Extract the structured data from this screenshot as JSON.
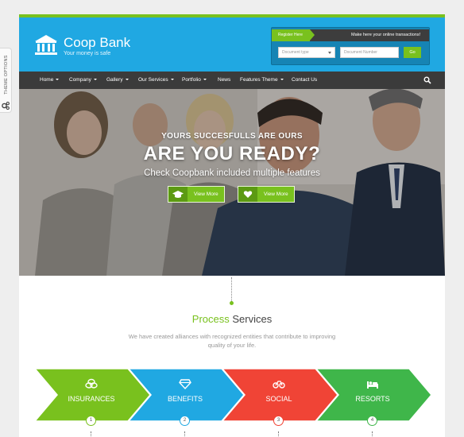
{
  "theme_options": {
    "label": "THEME OPTIONS"
  },
  "header": {
    "logo_title": "Coop Bank",
    "logo_subtitle": "Your money is safe",
    "register_label": "Register Here",
    "transaction_message": "Make here your online transactions!",
    "document_type_placeholder": "Document type",
    "document_number_placeholder": "Document Number",
    "go_label": "Go"
  },
  "nav": {
    "items": [
      {
        "label": "Home"
      },
      {
        "label": "Company"
      },
      {
        "label": "Gallery"
      },
      {
        "label": "Our Services"
      },
      {
        "label": "Portfolio"
      },
      {
        "label": "News"
      },
      {
        "label": "Features Theme"
      },
      {
        "label": "Contact Us"
      }
    ]
  },
  "hero": {
    "small_title": "YOURS SUCCESFULLS ARE OURS",
    "big_title": "ARE YOU READY?",
    "subtitle": "Check Coopbank included multiple features",
    "buttons": [
      {
        "label": "View More",
        "icon": "graduation-cap-icon"
      },
      {
        "label": "View More",
        "icon": "heart-icon"
      }
    ]
  },
  "process": {
    "title_highlight": "Process",
    "title_rest": " Services",
    "description": "We have created alliances with recognized entities that contribute to improving quality of your life.",
    "steps": [
      {
        "label": "INSURANCES",
        "number": "1",
        "color": "#79c11e",
        "icon": "coins-icon"
      },
      {
        "label": "BENEFITS",
        "number": "2",
        "color": "#20a8e2",
        "icon": "diamond-icon"
      },
      {
        "label": "SOCIAL",
        "number": "3",
        "color": "#f04436",
        "icon": "bicycle-icon"
      },
      {
        "label": "RESORTS",
        "number": "4",
        "color": "#3fb64a",
        "icon": "bed-icon"
      }
    ]
  },
  "colors": {
    "brand_blue": "#20a8e2",
    "brand_green": "#79c11e",
    "nav_dark": "#3b3b3b"
  }
}
